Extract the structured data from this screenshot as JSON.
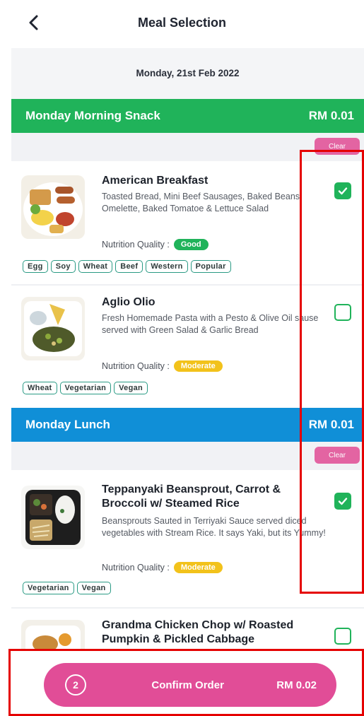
{
  "header": {
    "title": "Meal Selection"
  },
  "date": "Monday, 21st Feb 2022",
  "sections": [
    {
      "title": "Monday Morning Snack",
      "price": "RM 0.01",
      "clear_label": "Clear",
      "items": [
        {
          "name": "American Breakfast",
          "description": "Toasted Bread, Mini Beef Sausages, Baked Beans, Omelette, Baked Tomatoe & Lettuce Salad",
          "nutrition_label": "Nutrition Quality :",
          "nutrition_value": "Good",
          "tags": [
            "Egg",
            "Soy",
            "Wheat",
            "Beef",
            "Western",
            "Popular"
          ],
          "checked": true
        },
        {
          "name": "Aglio Olio",
          "description": "Fresh Homemade Pasta with a Pesto & Olive Oil sause served with Green Salad & Garlic Bread",
          "nutrition_label": "Nutrition Quality :",
          "nutrition_value": "Moderate",
          "tags": [
            "Wheat",
            "Vegetarian",
            "Vegan"
          ],
          "checked": false
        }
      ]
    },
    {
      "title": "Monday Lunch",
      "price": "RM 0.01",
      "clear_label": "Clear",
      "items": [
        {
          "name": "Teppanyaki Beansprout, Carrot & Broccoli w/ Steamed Rice",
          "description": "Beansprouts Sauted in Terriyaki Sauce served diced vegetables with Stream Rice. It says Yaki, but its Yummy!",
          "nutrition_label": "Nutrition Quality :",
          "nutrition_value": "Moderate",
          "tags": [
            "Vegetarian",
            "Vegan"
          ],
          "checked": true
        },
        {
          "name": "Grandma Chicken Chop w/ Roasted Pumpkin & Pickled Cabbage",
          "checked": false
        }
      ]
    }
  ],
  "footer": {
    "count": "2",
    "confirm_label": "Confirm Order",
    "total": "RM 0.02"
  },
  "colors": {
    "green": "#20b35a",
    "blue": "#108fd7",
    "pink": "#e14d97",
    "moderate": "#f2c21b",
    "highlight": "#e50000"
  }
}
